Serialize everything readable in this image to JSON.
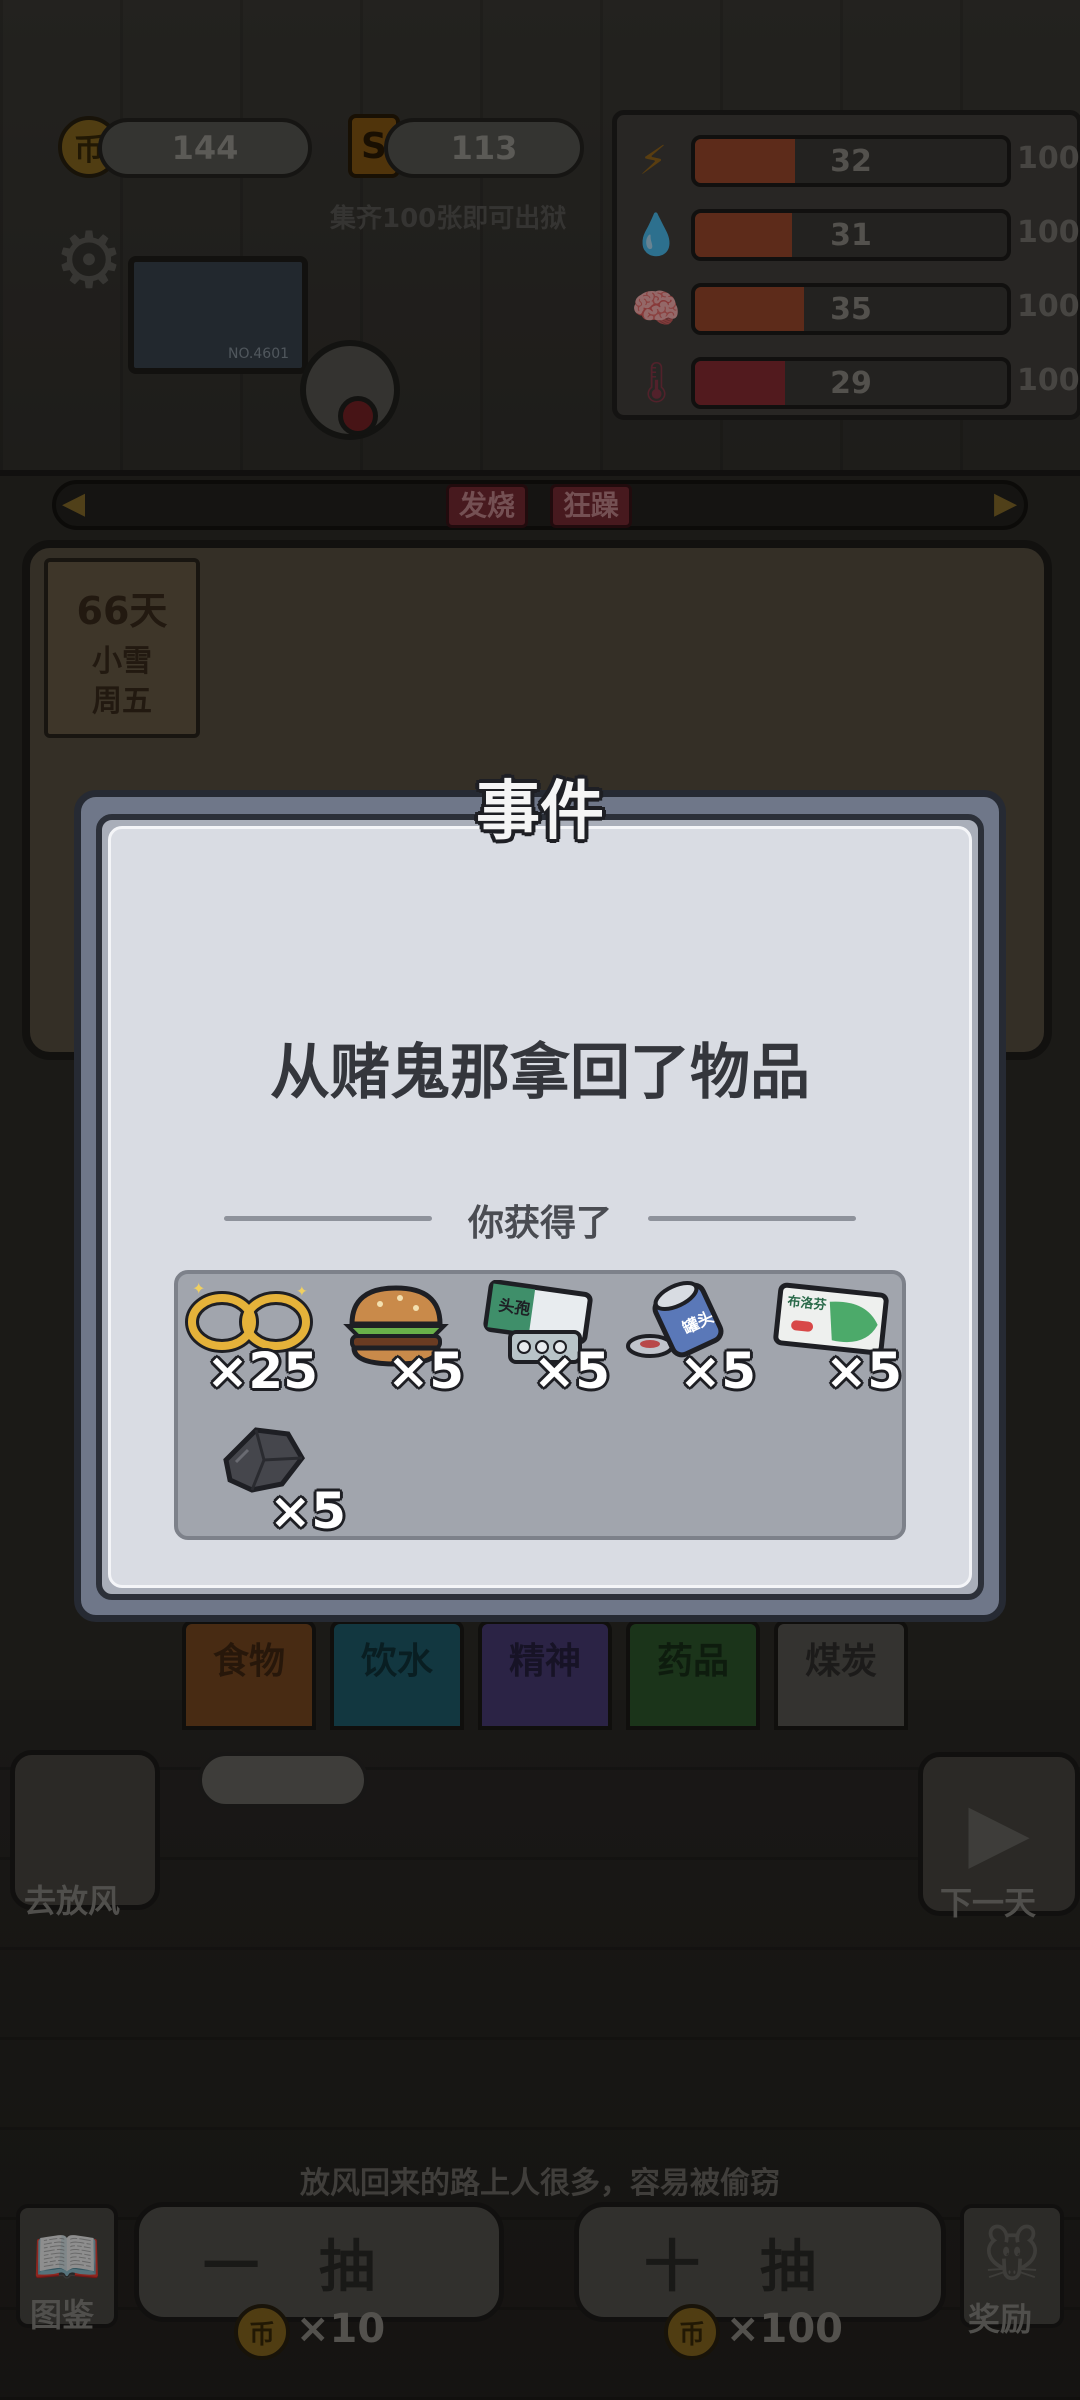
{
  "hud": {
    "coin_icon_glyph": "币",
    "coins": "144",
    "s_icon_glyph": "S",
    "cards": "113",
    "collect_hint": "集齐100张即可出狱",
    "avatar_id": "NO.4601"
  },
  "stats": [
    {
      "icon": "energy-icon",
      "glyph": "⚡",
      "value": "32",
      "max": "100",
      "level": 0.32,
      "color": "#a04a2e"
    },
    {
      "icon": "water-drop-icon",
      "glyph": "💧",
      "value": "31",
      "max": "100",
      "level": 0.31,
      "color": "#a04a2e"
    },
    {
      "icon": "brain-icon",
      "glyph": "🧠",
      "value": "35",
      "max": "100",
      "level": 0.35,
      "color": "#a04a2e"
    },
    {
      "icon": "thermometer-icon",
      "glyph": "🌡",
      "value": "29",
      "max": "100",
      "level": 0.29,
      "color": "#8e2e34"
    }
  ],
  "status_tags": [
    "发烧",
    "狂躁"
  ],
  "calendar": {
    "day": "66天",
    "weather": "小雪",
    "weekday": "周五"
  },
  "categories": [
    {
      "label": "食物",
      "color": "#7c4a22"
    },
    {
      "label": "饮水",
      "color": "#1f5f6e"
    },
    {
      "label": "精神",
      "color": "#4a3d78"
    },
    {
      "label": "药品",
      "color": "#2f5a2e"
    },
    {
      "label": "煤炭",
      "color": "#5a5853"
    }
  ],
  "controls": {
    "walk_label": "去放风",
    "next_label": "下一天",
    "hint": "放风回来的路上人很多，容易被偷窃",
    "album_label": "图鉴",
    "draw_one": "一抽",
    "draw_ten": "十抽",
    "draw_one_cost": "×10",
    "draw_ten_cost": "×100",
    "reward_label": "奖励"
  },
  "modal": {
    "title": "事件",
    "description": "从赌鬼那拿回了物品",
    "gain_label": "你获得了",
    "items": [
      {
        "name": "handcuffs",
        "qty": "×25"
      },
      {
        "name": "burger",
        "qty": "×5"
      },
      {
        "name": "headache-pills",
        "qty": "×5"
      },
      {
        "name": "canned-food",
        "qty": "×5"
      },
      {
        "name": "ibuprofen-box",
        "qty": "×5"
      },
      {
        "name": "coal",
        "qty": "×5"
      }
    ]
  }
}
